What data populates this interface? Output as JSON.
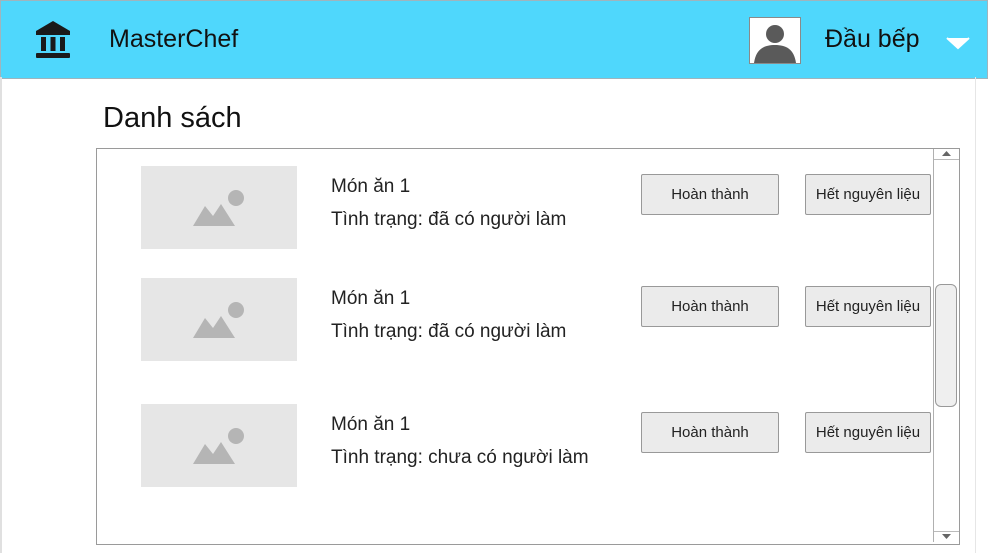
{
  "header": {
    "app_title": "MasterChef",
    "user_name": "Đầu bếp",
    "logo_icon": "bank-building-icon",
    "avatar_icon": "user-avatar-icon",
    "menu_icon": "chevron-down-icon",
    "background_color": "#4fd7fc"
  },
  "main": {
    "heading": "Danh sách",
    "items": [
      {
        "name": "Món ăn 1",
        "status": "Tình trạng: đã có người làm",
        "done_label": "Hoàn thành",
        "out_label": "Hết nguyên liệu",
        "image_icon": "image-placeholder-icon"
      },
      {
        "name": "Món ăn 1",
        "status": "Tình trạng: đã có người làm",
        "done_label": "Hoàn thành",
        "out_label": "Hết nguyên liệu",
        "image_icon": "image-placeholder-icon"
      },
      {
        "name": "Món ăn 1",
        "status": "Tình trạng: chưa có người làm",
        "done_label": "Hoàn thành",
        "out_label": "Hết nguyên liệu",
        "image_icon": "image-placeholder-icon"
      }
    ]
  }
}
